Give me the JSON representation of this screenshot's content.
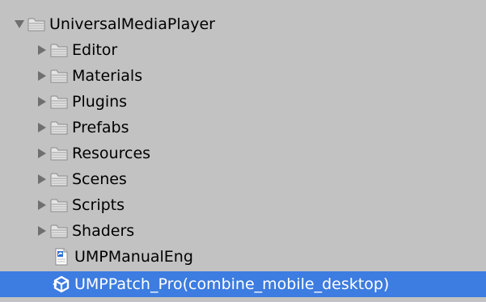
{
  "tree": {
    "root": {
      "label": "UniversalMediaPlayer",
      "expanded": true,
      "icon": "folder-icon"
    },
    "folders": [
      {
        "label": "Editor",
        "icon": "folder-icon"
      },
      {
        "label": "Materials",
        "icon": "folder-icon"
      },
      {
        "label": "Plugins",
        "icon": "folder-icon"
      },
      {
        "label": "Prefabs",
        "icon": "folder-icon"
      },
      {
        "label": "Resources",
        "icon": "folder-icon"
      },
      {
        "label": "Scenes",
        "icon": "folder-icon"
      },
      {
        "label": "Scripts",
        "icon": "folder-icon"
      },
      {
        "label": "Shaders",
        "icon": "folder-icon"
      }
    ],
    "files": [
      {
        "label": "UMPManualEng",
        "icon": "pdf-document-icon",
        "selected": false
      },
      {
        "label": "UMPPatch_Pro(combine_mobile_desktop)",
        "icon": "unity-package-icon",
        "selected": true
      }
    ]
  },
  "colors": {
    "background": "#c2c2c2",
    "selection": "#3d7ce0",
    "folder": "#e2e2e2",
    "arrow": "#6f6f6f"
  }
}
